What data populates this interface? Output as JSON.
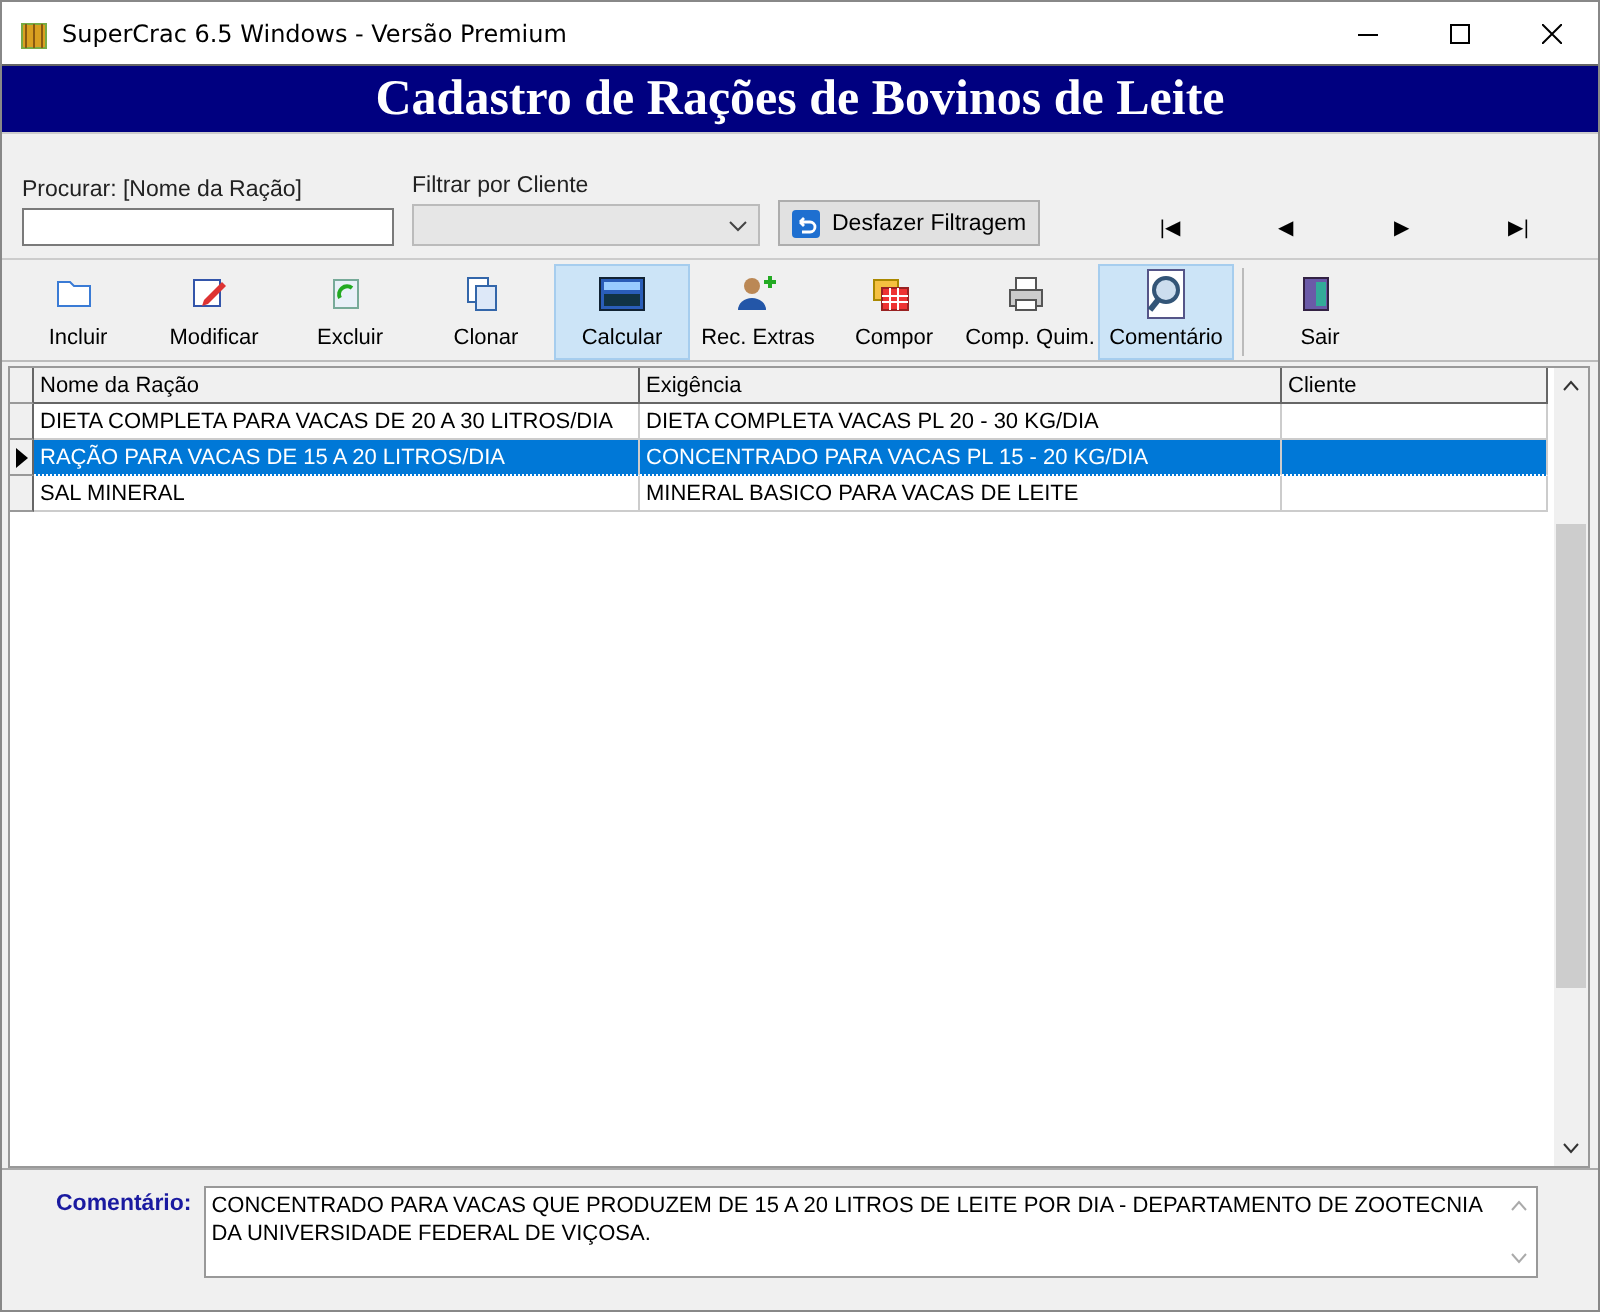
{
  "window": {
    "title": "SuperCrac 6.5 Windows - Versão Premium"
  },
  "banner": {
    "title": "Cadastro de Rações de Bovinos de Leite"
  },
  "search": {
    "label": "Procurar: [Nome da Ração]"
  },
  "client_filter": {
    "label": "Filtrar por Cliente",
    "disabled": true
  },
  "undo_filter_button": {
    "label": "Desfazer Filtragem"
  },
  "navigation": [
    "|◀",
    "◀",
    "▶",
    "▶|"
  ],
  "toolbar": [
    {
      "kind": "folder",
      "label": "Incluir",
      "active": false
    },
    {
      "kind": "edit",
      "label": "Modificar",
      "active": false
    },
    {
      "kind": "delete",
      "label": "Excluir",
      "active": false
    },
    {
      "kind": "copy",
      "label": "Clonar",
      "active": false
    },
    {
      "kind": "calc",
      "label": "Calcular",
      "active": true
    },
    {
      "kind": "person",
      "label": "Rec. Extras",
      "active": false
    },
    {
      "kind": "grid",
      "label": "Compor",
      "active": false
    },
    {
      "kind": "printer",
      "label": "Comp. Quim.",
      "active": false
    },
    {
      "kind": "magnifier",
      "label": "Comentário",
      "active": true
    },
    {
      "kind": "door",
      "label": "Sair",
      "active": false
    }
  ],
  "table": {
    "columns": [
      "Nome da Ração",
      "Exigência",
      "Cliente"
    ],
    "rows": [
      {
        "cells": [
          "DIETA COMPLETA PARA VACAS DE 20 A 30 LITROS/DIA",
          "DIETA COMPLETA VACAS PL 20 - 30 KG/DIA",
          ""
        ],
        "selected": false
      },
      {
        "cells": [
          "RAÇÃO PARA VACAS DE 15 A 20 LITROS/DIA",
          "CONCENTRADO PARA VACAS PL 15 - 20 KG/DIA",
          ""
        ],
        "selected": true
      },
      {
        "cells": [
          "SAL MINERAL",
          "MINERAL BASICO PARA VACAS DE LEITE",
          ""
        ],
        "selected": false
      }
    ]
  },
  "comment": {
    "label": "Comentário:",
    "value": "CONCENTRADO PARA VACAS QUE PRODUZEM DE 15 A 20 LITROS DE LEITE POR DIA - DEPARTAMENTO DE ZOOTECNIA DA UNIVERSIDADE FEDERAL DE VIÇOSA."
  }
}
